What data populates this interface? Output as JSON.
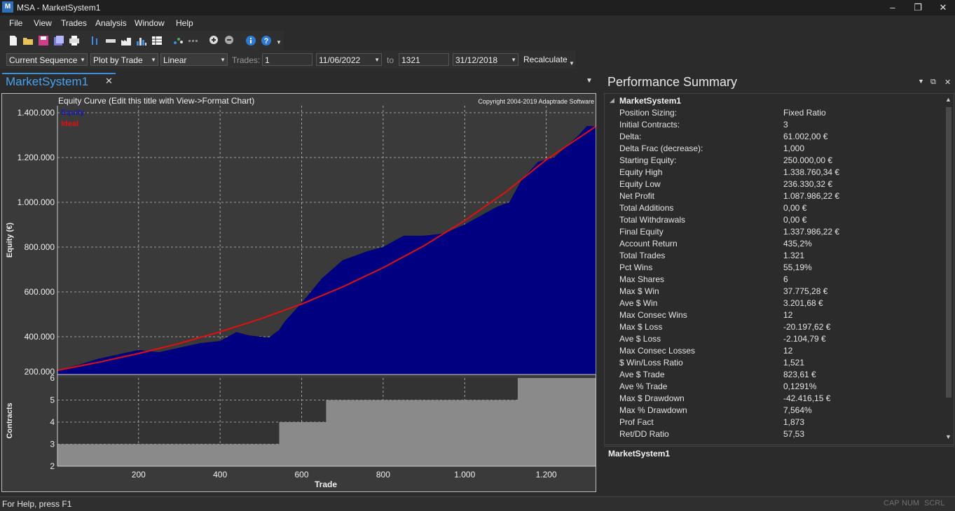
{
  "window": {
    "title": "MSA - MarketSystem1",
    "app_icon": "M",
    "min_glyph": "–",
    "max_glyph": "❐",
    "close_glyph": "✕"
  },
  "menu": [
    "File",
    "View",
    "Trades",
    "Analysis",
    "Window",
    "Help"
  ],
  "toolbar_icons": [
    "new-file-icon",
    "open-folder-icon",
    "save-icon",
    "save-as-icon",
    "print-icon",
    "price-bars-icon",
    "ruler-icon",
    "factory-icon",
    "histogram-icon",
    "table-icon",
    "scatter-icon",
    "sequence-icon",
    "zoom-in-icon",
    "zoom-out-icon",
    "info-icon",
    "help-icon"
  ],
  "toolbar2": {
    "sequence": "Current Sequence",
    "plot_mode": "Plot by Trade",
    "scale": "Linear",
    "trades_label": "Trades:",
    "trades_from": "1",
    "date_from": "11/06/2022",
    "to_label": "to",
    "trades_to": "1321",
    "date_to": "31/12/2018",
    "recalculate": "Recalculate"
  },
  "left_tab": {
    "label": "MarketSystem1",
    "close": "✕"
  },
  "chart": {
    "title": "Equity Curve (Edit this title with View->Format Chart)",
    "copyright": "Copyright 2004-2019 Adaptrade Software",
    "legend_equity": "Equity",
    "legend_ideal": "Ideal",
    "ylabel": "Equity (€)",
    "ylabel2": "Contracts",
    "xlabel": "Trade",
    "y_ticks": [
      "1.400.000",
      "1.200.000",
      "1.000.000",
      "800.000",
      "600.000",
      "400.000",
      "200.000"
    ],
    "y2_ticks": [
      "6",
      "5",
      "4",
      "3",
      "2"
    ],
    "x_ticks": [
      "200",
      "400",
      "600",
      "800",
      "1.000",
      "1.200"
    ]
  },
  "chart_data": {
    "type": "area",
    "title": "Equity Curve (Edit this title with View->Format Chart)",
    "xlabel": "Trade",
    "ylabel": "Equity (€)",
    "xlim": [
      1,
      1321
    ],
    "ylim": [
      200000,
      1400000
    ],
    "grid": true,
    "legend": "top-left",
    "series": [
      {
        "name": "Equity",
        "color": "#000080",
        "x": [
          1,
          50,
          100,
          150,
          200,
          250,
          300,
          350,
          400,
          440,
          470,
          520,
          545,
          560,
          600,
          650,
          700,
          730,
          760,
          800,
          850,
          900,
          950,
          1000,
          1050,
          1080,
          1110,
          1140,
          1180,
          1220,
          1250,
          1280,
          1300,
          1321
        ],
        "y": [
          250000,
          272000,
          300000,
          320000,
          340000,
          330000,
          350000,
          370000,
          380000,
          420000,
          405000,
          395000,
          430000,
          470000,
          550000,
          660000,
          740000,
          760000,
          780000,
          800000,
          850000,
          850000,
          860000,
          900000,
          950000,
          980000,
          1000000,
          1100000,
          1180000,
          1200000,
          1250000,
          1300000,
          1340000,
          1338000
        ]
      },
      {
        "name": "Ideal",
        "color": "#e01010",
        "x": [
          1,
          100,
          200,
          300,
          400,
          500,
          600,
          700,
          800,
          900,
          1000,
          1100,
          1200,
          1321
        ],
        "y": [
          250000,
          285000,
          325000,
          370000,
          422000,
          480000,
          546000,
          622000,
          708000,
          806000,
          918000,
          1045000,
          1190000,
          1338000
        ]
      }
    ],
    "contracts": {
      "ylim": [
        2,
        6
      ],
      "x": [
        1,
        545,
        660,
        1110,
        1130,
        1321
      ],
      "y": [
        3,
        4,
        5,
        5,
        6,
        6
      ]
    }
  },
  "summary": {
    "title": "Performance Summary",
    "header": "MarketSystem1",
    "rows": [
      [
        "Position Sizing:",
        "Fixed Ratio"
      ],
      [
        "Initial Contracts:",
        "3"
      ],
      [
        "Delta:",
        "61.002,00 €"
      ],
      [
        "Delta Frac (decrease):",
        "1,000"
      ],
      [
        "Starting Equity:",
        "250.000,00 €"
      ],
      [
        "Equity High",
        "1.338.760,34 €"
      ],
      [
        "Equity Low",
        "236.330,32 €"
      ],
      [
        "Net Profit",
        "1.087.986,22 €"
      ],
      [
        "Total Additions",
        "0,00 €"
      ],
      [
        "Total Withdrawals",
        "0,00 €"
      ],
      [
        "Final Equity",
        "1.337.986,22 €"
      ],
      [
        "Account Return",
        "435,2%"
      ],
      [
        "Total Trades",
        "1.321"
      ],
      [
        "Pct Wins",
        "55,19%"
      ],
      [
        "Max Shares",
        "6"
      ],
      [
        "Max $ Win",
        "37.775,28 €"
      ],
      [
        "Ave $ Win",
        "3.201,68 €"
      ],
      [
        "Max Consec Wins",
        "12"
      ],
      [
        "Max $ Loss",
        "-20.197,62 €"
      ],
      [
        "Ave $ Loss",
        "-2.104,79 €"
      ],
      [
        "Max Consec Losses",
        "12"
      ],
      [
        "$ Win/Loss Ratio",
        "1,521"
      ],
      [
        "Ave $ Trade",
        "823,61 €"
      ],
      [
        "Ave % Trade",
        "0,1291%"
      ],
      [
        "Max $ Drawdown",
        "-42.416,15 €"
      ],
      [
        "Max % Drawdown",
        "7,564%"
      ],
      [
        "Prof Fact",
        "1,873"
      ],
      [
        "Ret/DD Ratio",
        "57,53"
      ]
    ],
    "panel2_title": "MarketSystem1"
  },
  "status": {
    "help": "For Help, press F1",
    "cap": "CAP",
    "num": "NUM",
    "scrl": "SCRL"
  }
}
